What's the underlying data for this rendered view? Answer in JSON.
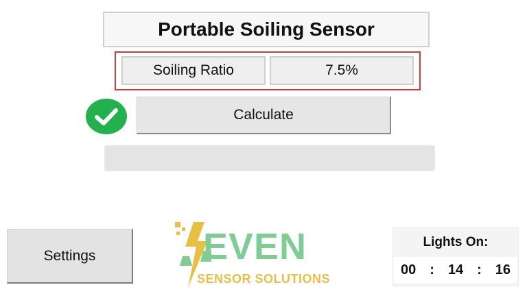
{
  "header": {
    "title": "Portable Soiling Sensor"
  },
  "soiling": {
    "label": "Soiling Ratio",
    "value": "7.5%"
  },
  "status": {
    "icon": "check-circle-icon",
    "color": "#22b14c"
  },
  "calculate": {
    "label": "Calculate"
  },
  "progress": {
    "value": 0
  },
  "settings": {
    "label": "Settings"
  },
  "logo": {
    "main": "EVEN",
    "sub": "SENSOR SOLUTIONS",
    "primary_color": "#80cc95",
    "accent_color": "#e8bf45"
  },
  "lights": {
    "title": "Lights On:",
    "hours": "00",
    "minutes": "14",
    "seconds": "16",
    "separator": ":"
  },
  "colors": {
    "highlight_border": "#d33a3a"
  }
}
